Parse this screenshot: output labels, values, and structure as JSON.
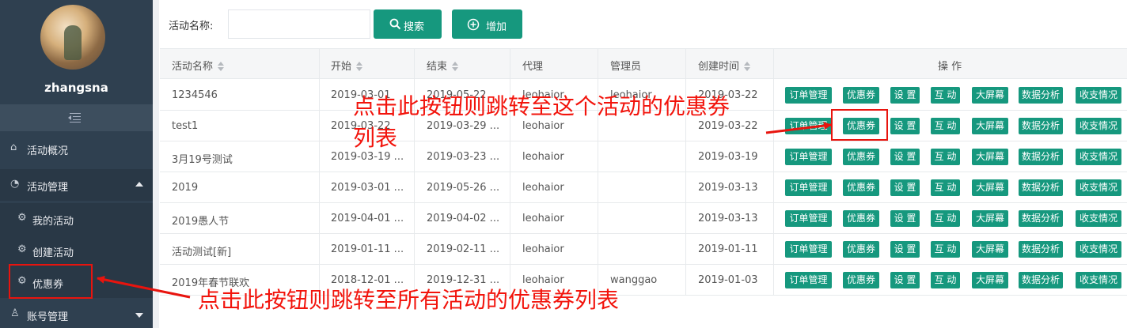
{
  "sidebar": {
    "username": "zhangsna",
    "menu": {
      "overview": "活动概况",
      "manage": "活动管理",
      "my_activities": "我的活动",
      "create": "创建活动",
      "coupon": "优惠券",
      "account": "账号管理"
    }
  },
  "search": {
    "label": "活动名称:",
    "value": "",
    "search_button": "搜索",
    "add_button": "增加"
  },
  "table": {
    "headers": [
      "活动名称",
      "开始",
      "结束",
      "代理",
      "管理员",
      "创建时间",
      "操 作"
    ],
    "actions": [
      "订单管理",
      "优惠券",
      "设 置",
      "互 动",
      "大屏幕",
      "数据分析",
      "收支情况"
    ],
    "rows": [
      {
        "name": "1234546",
        "start": "2019-03-01",
        "end": "2019-05-22",
        "agent": "leohaior",
        "admin": "leohaior",
        "created": "2019-03-22"
      },
      {
        "name": "test1",
        "start": "2019-03-22",
        "end": "2019-03-29 ...",
        "agent": "leohaior",
        "admin": "",
        "created": "2019-03-22"
      },
      {
        "name": "3月19号测试",
        "start": "2019-03-19 ...",
        "end": "2019-03-23 ...",
        "agent": "leohaior",
        "admin": "",
        "created": "2019-03-19"
      },
      {
        "name": "2019",
        "start": "2019-03-01 ...",
        "end": "2019-05-26 ...",
        "agent": "leohaior",
        "admin": "",
        "created": "2019-03-13"
      },
      {
        "name": "2019愚人节",
        "start": "2019-04-01 ...",
        "end": "2019-04-02 ...",
        "agent": "leohaior",
        "admin": "",
        "created": "2019-03-13"
      },
      {
        "name": "活动测试[新]",
        "start": "2019-01-11 ...",
        "end": "2019-02-11 ...",
        "agent": "leohaior",
        "admin": "",
        "created": "2019-01-11"
      },
      {
        "name": "2019年春节联欢",
        "start": "2018-12-01 ...",
        "end": "2019-12-31 ...",
        "agent": "leohaior",
        "admin": "wanggao",
        "created": "2019-01-03"
      }
    ]
  },
  "annotations": {
    "top_line1": "点击此按钮则跳转至这个活动的优惠券",
    "top_line2": "列表",
    "bottom": "点击此按钮则跳转至所有活动的优惠券列表",
    "color": "#f2140c"
  },
  "colors": {
    "sidebar_bg": "#2f4050",
    "button_green": "#16987e"
  }
}
